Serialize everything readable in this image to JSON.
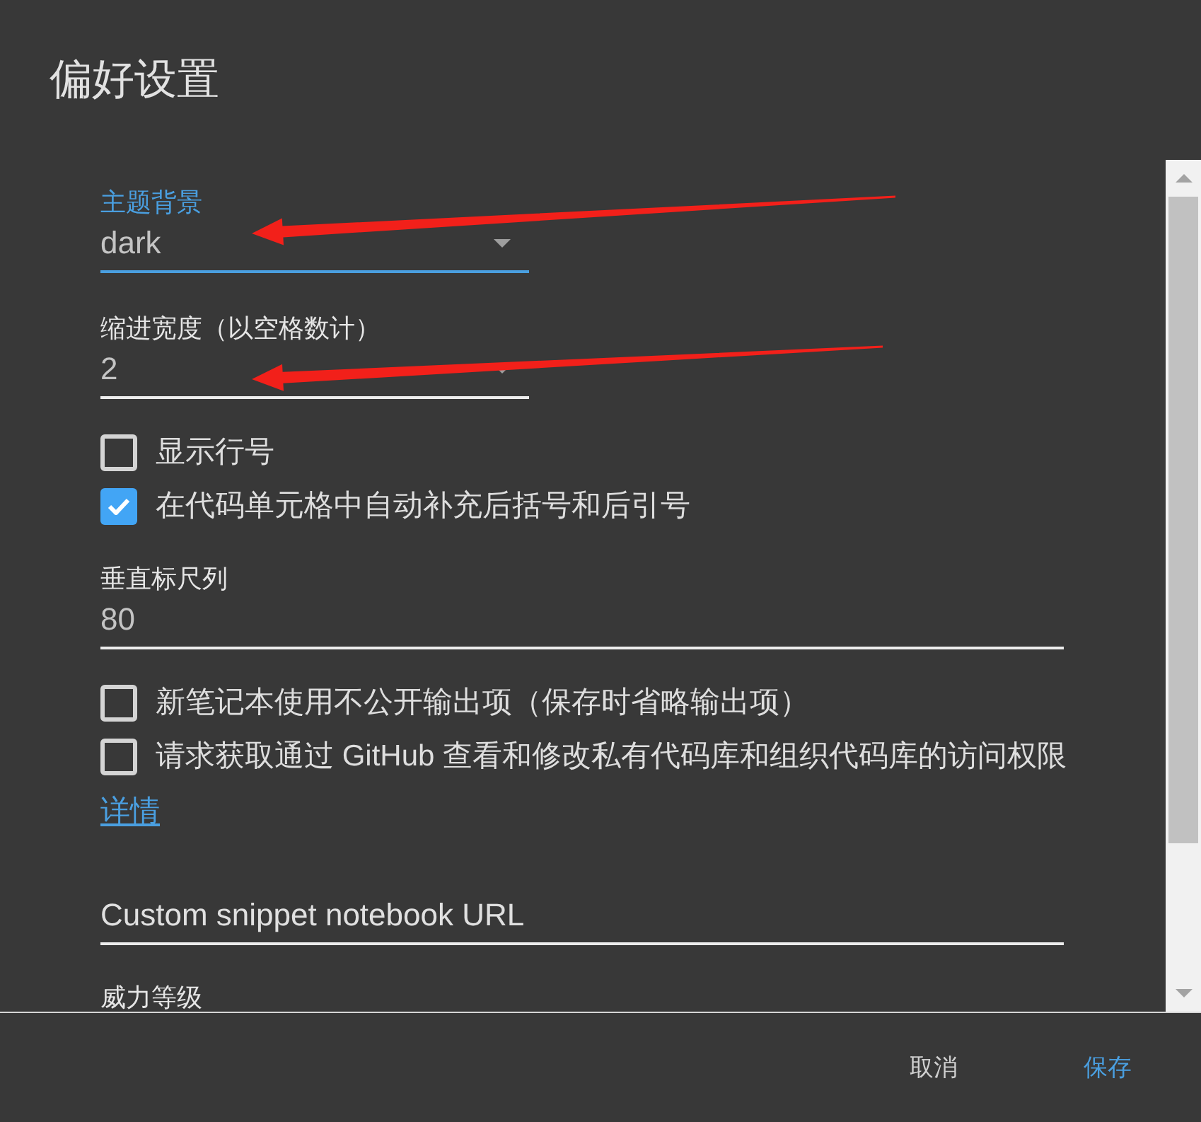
{
  "dialog": {
    "title": "偏好设置"
  },
  "settings": [
    {
      "kind": "select",
      "label": "主题背景",
      "value": "dark",
      "focused": true,
      "annotated": true
    },
    {
      "kind": "select",
      "label": "缩进宽度（以空格数计）",
      "value": "2",
      "focused": false,
      "annotated": true
    },
    {
      "kind": "checkbox",
      "label": "显示行号",
      "checked": false
    },
    {
      "kind": "checkbox",
      "label": "在代码单元格中自动补充后括号和后引号",
      "checked": true
    },
    {
      "kind": "text",
      "label": "垂直标尺列",
      "value": "80"
    },
    {
      "kind": "checkbox",
      "label": "新笔记本使用不公开输出项（保存时省略输出项）",
      "checked": false
    },
    {
      "kind": "checkbox",
      "label": "请求获取通过 GitHub 查看和修改私有代码库和组织代码库的访问权限",
      "checked": false
    },
    {
      "kind": "link",
      "label": "详情"
    },
    {
      "kind": "text",
      "placeholder": "Custom snippet notebook URL"
    },
    {
      "kind": "label",
      "label": "威力等级"
    }
  ],
  "buttons": [
    {
      "label": "取消",
      "primary": false
    },
    {
      "label": "保存",
      "primary": true
    }
  ]
}
